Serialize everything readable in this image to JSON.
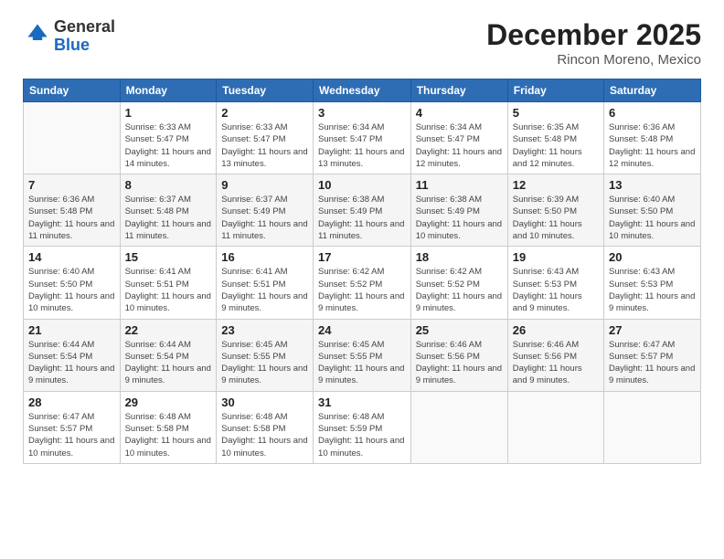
{
  "logo": {
    "general": "General",
    "blue": "Blue"
  },
  "title": "December 2025",
  "location": "Rincon Moreno, Mexico",
  "days_of_week": [
    "Sunday",
    "Monday",
    "Tuesday",
    "Wednesday",
    "Thursday",
    "Friday",
    "Saturday"
  ],
  "weeks": [
    [
      {
        "day": "",
        "sunrise": "",
        "sunset": "",
        "daylight": ""
      },
      {
        "day": "1",
        "sunrise": "6:33 AM",
        "sunset": "5:47 PM",
        "daylight": "11 hours and 14 minutes."
      },
      {
        "day": "2",
        "sunrise": "6:33 AM",
        "sunset": "5:47 PM",
        "daylight": "11 hours and 13 minutes."
      },
      {
        "day": "3",
        "sunrise": "6:34 AM",
        "sunset": "5:47 PM",
        "daylight": "11 hours and 13 minutes."
      },
      {
        "day": "4",
        "sunrise": "6:34 AM",
        "sunset": "5:47 PM",
        "daylight": "11 hours and 12 minutes."
      },
      {
        "day": "5",
        "sunrise": "6:35 AM",
        "sunset": "5:48 PM",
        "daylight": "11 hours and 12 minutes."
      },
      {
        "day": "6",
        "sunrise": "6:36 AM",
        "sunset": "5:48 PM",
        "daylight": "11 hours and 12 minutes."
      }
    ],
    [
      {
        "day": "7",
        "sunrise": "6:36 AM",
        "sunset": "5:48 PM",
        "daylight": "11 hours and 11 minutes."
      },
      {
        "day": "8",
        "sunrise": "6:37 AM",
        "sunset": "5:48 PM",
        "daylight": "11 hours and 11 minutes."
      },
      {
        "day": "9",
        "sunrise": "6:37 AM",
        "sunset": "5:49 PM",
        "daylight": "11 hours and 11 minutes."
      },
      {
        "day": "10",
        "sunrise": "6:38 AM",
        "sunset": "5:49 PM",
        "daylight": "11 hours and 11 minutes."
      },
      {
        "day": "11",
        "sunrise": "6:38 AM",
        "sunset": "5:49 PM",
        "daylight": "11 hours and 10 minutes."
      },
      {
        "day": "12",
        "sunrise": "6:39 AM",
        "sunset": "5:50 PM",
        "daylight": "11 hours and 10 minutes."
      },
      {
        "day": "13",
        "sunrise": "6:40 AM",
        "sunset": "5:50 PM",
        "daylight": "11 hours and 10 minutes."
      }
    ],
    [
      {
        "day": "14",
        "sunrise": "6:40 AM",
        "sunset": "5:50 PM",
        "daylight": "11 hours and 10 minutes."
      },
      {
        "day": "15",
        "sunrise": "6:41 AM",
        "sunset": "5:51 PM",
        "daylight": "11 hours and 10 minutes."
      },
      {
        "day": "16",
        "sunrise": "6:41 AM",
        "sunset": "5:51 PM",
        "daylight": "11 hours and 9 minutes."
      },
      {
        "day": "17",
        "sunrise": "6:42 AM",
        "sunset": "5:52 PM",
        "daylight": "11 hours and 9 minutes."
      },
      {
        "day": "18",
        "sunrise": "6:42 AM",
        "sunset": "5:52 PM",
        "daylight": "11 hours and 9 minutes."
      },
      {
        "day": "19",
        "sunrise": "6:43 AM",
        "sunset": "5:53 PM",
        "daylight": "11 hours and 9 minutes."
      },
      {
        "day": "20",
        "sunrise": "6:43 AM",
        "sunset": "5:53 PM",
        "daylight": "11 hours and 9 minutes."
      }
    ],
    [
      {
        "day": "21",
        "sunrise": "6:44 AM",
        "sunset": "5:54 PM",
        "daylight": "11 hours and 9 minutes."
      },
      {
        "day": "22",
        "sunrise": "6:44 AM",
        "sunset": "5:54 PM",
        "daylight": "11 hours and 9 minutes."
      },
      {
        "day": "23",
        "sunrise": "6:45 AM",
        "sunset": "5:55 PM",
        "daylight": "11 hours and 9 minutes."
      },
      {
        "day": "24",
        "sunrise": "6:45 AM",
        "sunset": "5:55 PM",
        "daylight": "11 hours and 9 minutes."
      },
      {
        "day": "25",
        "sunrise": "6:46 AM",
        "sunset": "5:56 PM",
        "daylight": "11 hours and 9 minutes."
      },
      {
        "day": "26",
        "sunrise": "6:46 AM",
        "sunset": "5:56 PM",
        "daylight": "11 hours and 9 minutes."
      },
      {
        "day": "27",
        "sunrise": "6:47 AM",
        "sunset": "5:57 PM",
        "daylight": "11 hours and 9 minutes."
      }
    ],
    [
      {
        "day": "28",
        "sunrise": "6:47 AM",
        "sunset": "5:57 PM",
        "daylight": "11 hours and 10 minutes."
      },
      {
        "day": "29",
        "sunrise": "6:48 AM",
        "sunset": "5:58 PM",
        "daylight": "11 hours and 10 minutes."
      },
      {
        "day": "30",
        "sunrise": "6:48 AM",
        "sunset": "5:58 PM",
        "daylight": "11 hours and 10 minutes."
      },
      {
        "day": "31",
        "sunrise": "6:48 AM",
        "sunset": "5:59 PM",
        "daylight": "11 hours and 10 minutes."
      },
      {
        "day": "",
        "sunrise": "",
        "sunset": "",
        "daylight": ""
      },
      {
        "day": "",
        "sunrise": "",
        "sunset": "",
        "daylight": ""
      },
      {
        "day": "",
        "sunrise": "",
        "sunset": "",
        "daylight": ""
      }
    ]
  ],
  "labels": {
    "sunrise": "Sunrise:",
    "sunset": "Sunset:",
    "daylight": "Daylight:"
  }
}
